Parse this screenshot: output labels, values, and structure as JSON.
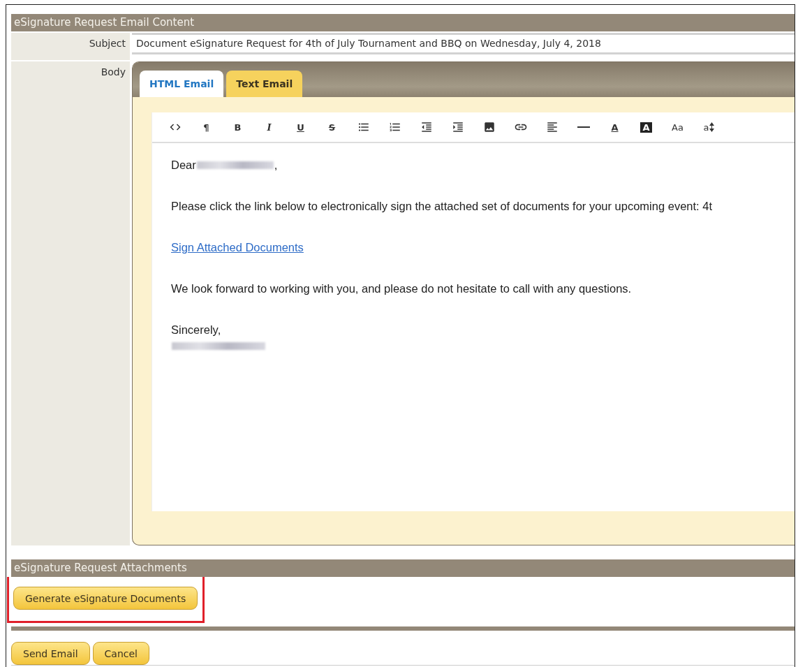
{
  "email_section": {
    "title": "eSignature Request Email Content",
    "subject": {
      "label": "Subject",
      "value": "Document eSignature Request for 4th of July Tournament and BBQ on Wednesday, July 4, 2018"
    },
    "body": {
      "label": "Body",
      "tabs": [
        {
          "label": "HTML Email",
          "selected": true
        },
        {
          "label": "Text Email",
          "selected": false
        }
      ],
      "toolbar": [
        {
          "kind": "code"
        },
        {
          "kind": "char",
          "label": "¶"
        },
        {
          "kind": "bold",
          "label": "B"
        },
        {
          "kind": "italic",
          "label": "I"
        },
        {
          "kind": "underline",
          "label": "U"
        },
        {
          "kind": "strike",
          "label": "S"
        },
        {
          "kind": "bullets"
        },
        {
          "kind": "numbers"
        },
        {
          "kind": "outdent"
        },
        {
          "kind": "indent"
        },
        {
          "kind": "image"
        },
        {
          "kind": "link"
        },
        {
          "kind": "align"
        },
        {
          "kind": "rule"
        },
        {
          "kind": "color",
          "label": "A"
        },
        {
          "kind": "highlight",
          "label": "A"
        },
        {
          "kind": "size",
          "label": "Aa"
        },
        {
          "kind": "lineheight",
          "label": "a"
        }
      ],
      "content": [
        {
          "kind": "greeting",
          "text": "Dear",
          "suffix": ","
        },
        {
          "kind": "text",
          "text": "Please click the link below to electronically sign the attached set of documents for your upcoming event: 4t"
        },
        {
          "kind": "link",
          "text": "Sign Attached Documents"
        },
        {
          "kind": "text",
          "text": "We look forward to working with you, and please do not hesitate to call with any questions."
        },
        {
          "kind": "signoff",
          "text": "Sincerely,"
        }
      ]
    }
  },
  "attachments_section": {
    "title": "eSignature Request Attachments",
    "button": "Generate eSignature Documents",
    "highlighted": true
  },
  "actions": [
    "Send Email",
    "Cancel"
  ]
}
